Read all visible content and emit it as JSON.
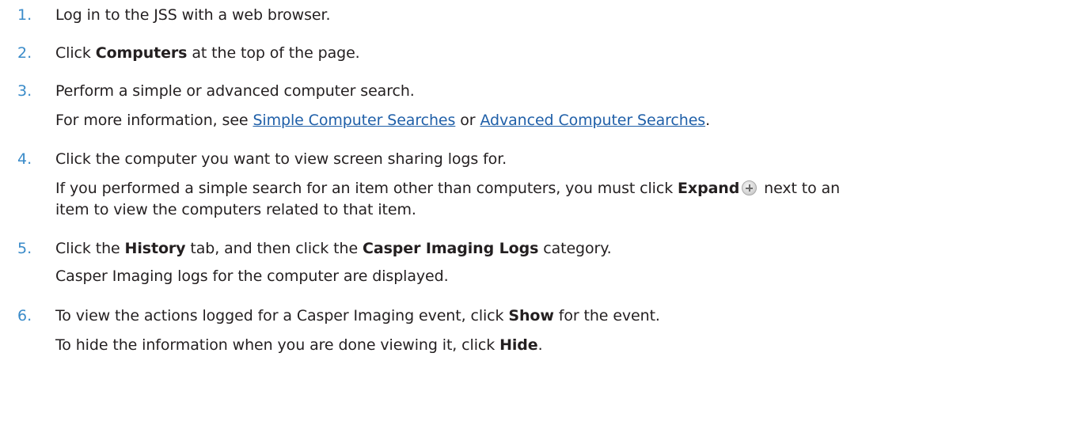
{
  "steps": [
    {
      "number": "1.",
      "text": "Log in to the JSS with a web browser."
    },
    {
      "number": "2.",
      "pre": "Click ",
      "bold": "Computers",
      "post": " at the top of the page."
    },
    {
      "number": "3.",
      "text": "Perform a simple or advanced computer search.",
      "note_pre": "For more information, see ",
      "link1": "Simple Computer Searches",
      "note_mid": " or ",
      "link2": "Advanced Computer Searches",
      "note_post": "."
    },
    {
      "number": "4.",
      "text": "Click the computer you want to view screen sharing logs for.",
      "note_pre": "If you performed a simple search for an item other than computers, you must click ",
      "note_bold": "Expand",
      "note_post": " next to an",
      "note_line2": "item to view the computers related to that item.",
      "icon": "expand-plus-icon"
    },
    {
      "number": "5.",
      "pre": "Click the ",
      "bold1": "History",
      "mid": " tab, and then click the ",
      "bold2": "Casper Imaging Logs",
      "post": " category.",
      "note": "Casper Imaging logs for the computer are displayed."
    },
    {
      "number": "6.",
      "pre": "To view the actions logged for a Casper Imaging event, click ",
      "bold": "Show",
      "post": " for the event.",
      "note_pre": "To hide the information when you are done viewing it, click ",
      "note_bold": "Hide",
      "note_post": "."
    }
  ],
  "colors": {
    "number": "#3a8bc9",
    "text": "#231f20",
    "link": "#1f5fa8"
  }
}
